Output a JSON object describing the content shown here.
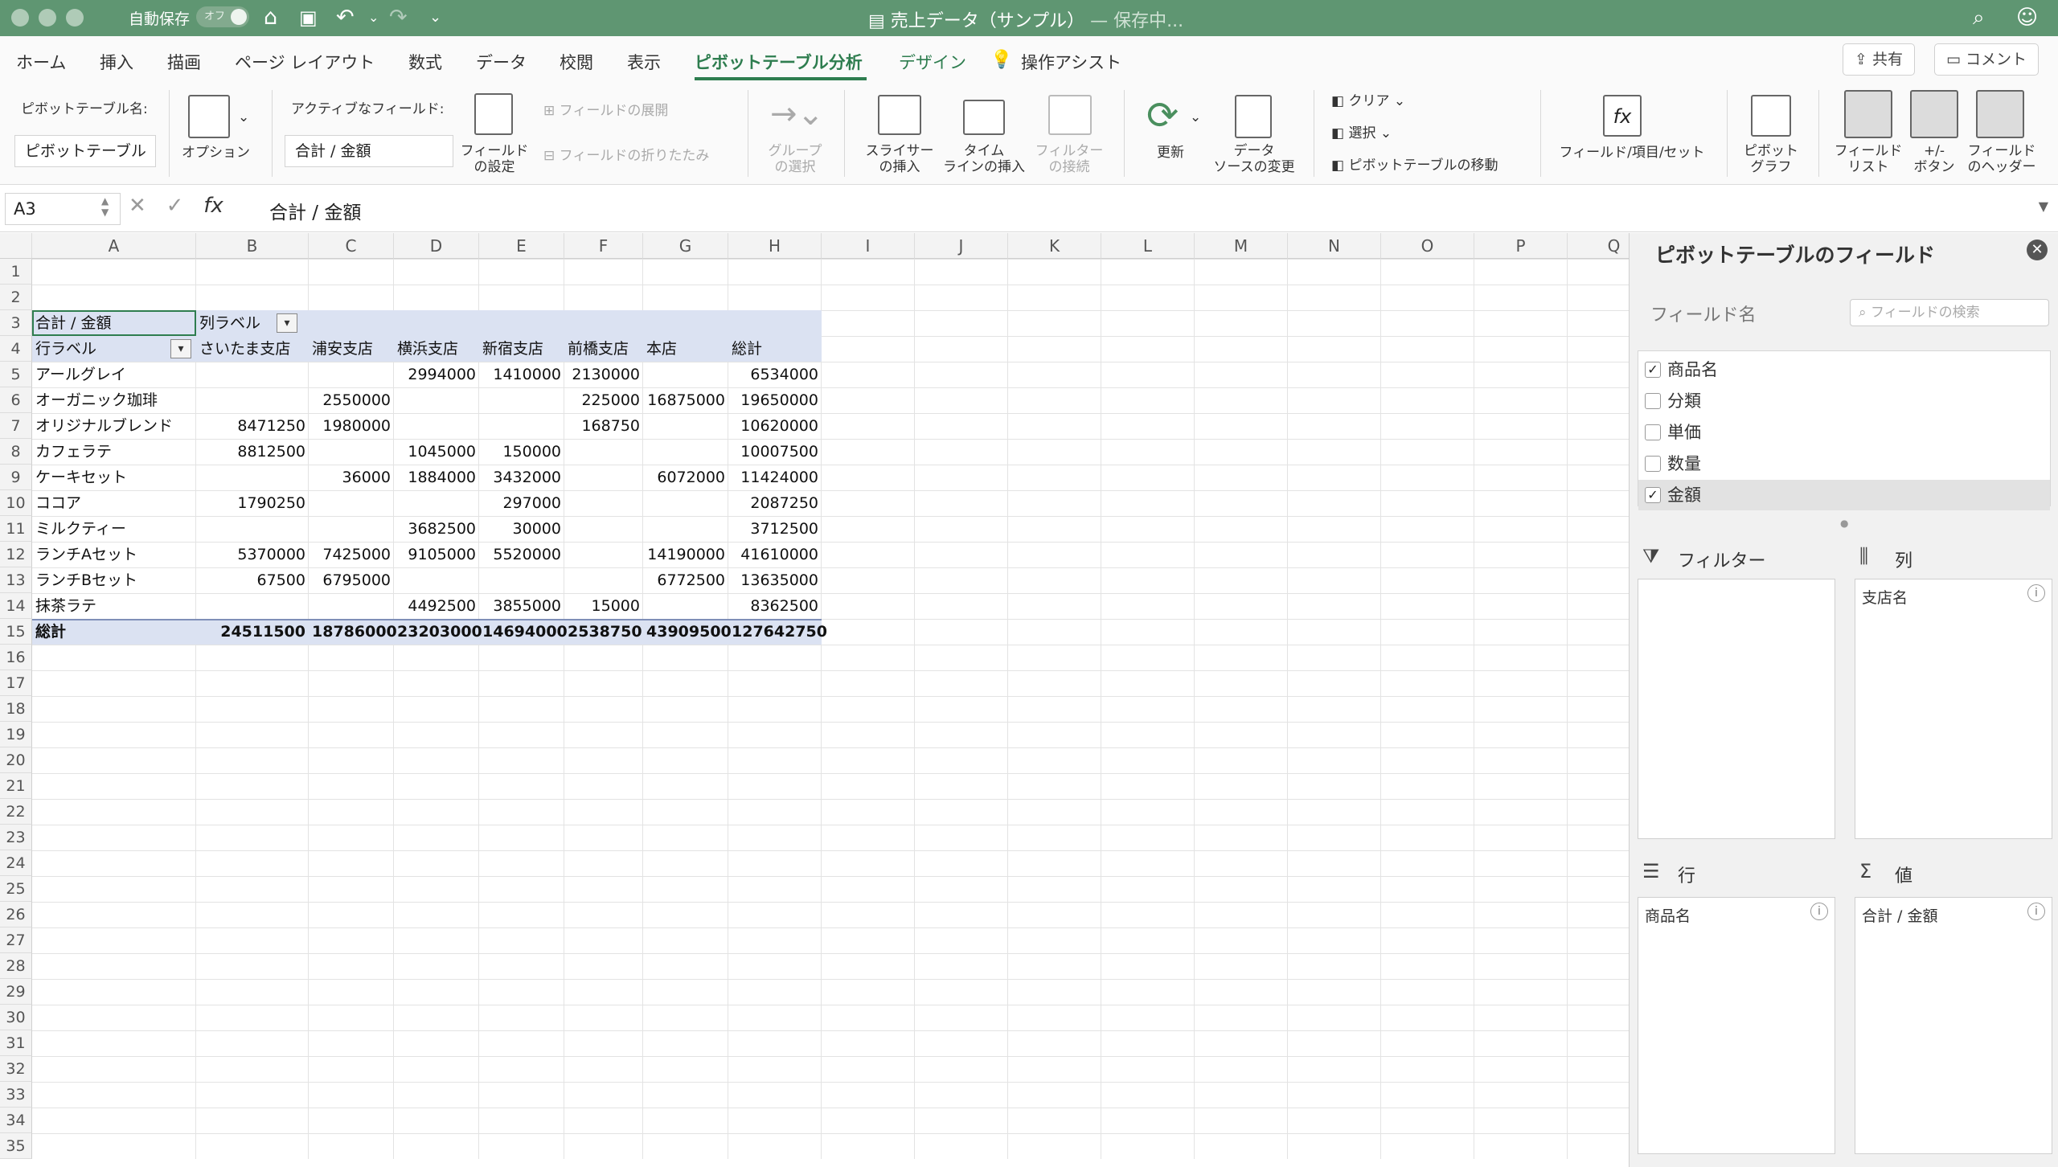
{
  "titlebar": {
    "autosave": "自動保存",
    "toggle": "オフ",
    "doc_title": "売上データ（サンプル）",
    "status": "— 保存中..."
  },
  "menu": {
    "tabs": [
      "ホーム",
      "挿入",
      "描画",
      "ページ レイアウト",
      "数式",
      "データ",
      "校閲",
      "表示",
      "ピボットテーブル分析",
      "デザイン",
      "操作アシスト"
    ],
    "active": "ピボットテーブル分析",
    "share": "共有",
    "comment": "コメント"
  },
  "ribbon": {
    "pt_name_label": "ピボットテーブル名:",
    "pt_name_value": "ピボットテーブル",
    "options": "オプション",
    "active_field_label": "アクティブなフィールド:",
    "active_field_value": "合計 / 金額",
    "field_settings": [
      "フィールド",
      "の設定"
    ],
    "expand": "フィールドの展開",
    "collapse": "フィールドの折りたたみ",
    "group": [
      "グループ",
      "の選択"
    ],
    "slicer": [
      "スライサー",
      "の挿入"
    ],
    "timeline": [
      "タイム",
      "ラインの挿入"
    ],
    "filter_conn": [
      "フィルター",
      "の接続"
    ],
    "refresh": "更新",
    "change_source": [
      "データ",
      "ソースの変更"
    ],
    "clear": "クリア",
    "select": "選択",
    "move": "ピボットテーブルの移動",
    "fields_items": "フィールド/項目/セット",
    "pivot_chart": [
      "ピボット",
      "グラフ"
    ],
    "field_list": [
      "フィールド",
      "リスト"
    ],
    "plusminus": [
      "+/-",
      "ボタン"
    ],
    "field_headers": [
      "フィールド",
      "のヘッダー"
    ]
  },
  "formula": {
    "cell_ref": "A3",
    "content": "合計 / 金額"
  },
  "sheet": {
    "columns": [
      "A",
      "B",
      "C",
      "D",
      "E",
      "F",
      "G",
      "H",
      "I",
      "J",
      "K",
      "L",
      "M",
      "N",
      "O",
      "P",
      "Q"
    ],
    "row_count": 35,
    "pivot": {
      "corner": "合計 / 金額",
      "col_label": "列ラベル",
      "row_label": "行ラベル",
      "headers": [
        "さいたま支店",
        "浦安支店",
        "横浜支店",
        "新宿支店",
        "前橋支店",
        "本店",
        "総計"
      ],
      "rows": [
        {
          "name": "アールグレイ",
          "values": [
            "",
            "",
            "2994000",
            "1410000",
            "2130000",
            "",
            "6534000"
          ]
        },
        {
          "name": "オーガニック珈琲",
          "values": [
            "",
            "2550000",
            "",
            "",
            "225000",
            "16875000",
            "19650000"
          ]
        },
        {
          "name": "オリジナルブレンド",
          "values": [
            "8471250",
            "1980000",
            "",
            "",
            "168750",
            "",
            "10620000"
          ]
        },
        {
          "name": "カフェラテ",
          "values": [
            "8812500",
            "",
            "1045000",
            "150000",
            "",
            "",
            "10007500"
          ]
        },
        {
          "name": "ケーキセット",
          "values": [
            "",
            "36000",
            "1884000",
            "3432000",
            "",
            "6072000",
            "11424000"
          ]
        },
        {
          "name": "ココア",
          "values": [
            "1790250",
            "",
            "",
            "297000",
            "",
            "",
            "2087250"
          ]
        },
        {
          "name": "ミルクティー",
          "values": [
            "",
            "",
            "3682500",
            "30000",
            "",
            "",
            "3712500"
          ]
        },
        {
          "name": "ランチAセット",
          "values": [
            "5370000",
            "7425000",
            "9105000",
            "5520000",
            "",
            "14190000",
            "41610000"
          ]
        },
        {
          "name": "ランチBセット",
          "values": [
            "67500",
            "6795000",
            "",
            "",
            "",
            "6772500",
            "13635000"
          ]
        },
        {
          "name": "抹茶ラテ",
          "values": [
            "",
            "",
            "4492500",
            "3855000",
            "15000",
            "",
            "8362500"
          ]
        }
      ],
      "total": {
        "name": "総計",
        "values": [
          "24511500",
          "18786000",
          "23203000",
          "14694000",
          "2538750",
          "43909500",
          "127642750"
        ]
      }
    }
  },
  "panel": {
    "title": "ピボットテーブルのフィールド",
    "field_name": "フィールド名",
    "search_placeholder": "フィールドの検索",
    "fields": [
      {
        "name": "商品名",
        "checked": true
      },
      {
        "name": "分類",
        "checked": false
      },
      {
        "name": "単価",
        "checked": false
      },
      {
        "name": "数量",
        "checked": false
      },
      {
        "name": "金額",
        "checked": true
      }
    ],
    "areas": {
      "filter": "フィルター",
      "columns": "列",
      "rows": "行",
      "values": "値"
    },
    "column_item": "支店名",
    "row_item": "商品名",
    "value_item": "合計 / 金額"
  }
}
